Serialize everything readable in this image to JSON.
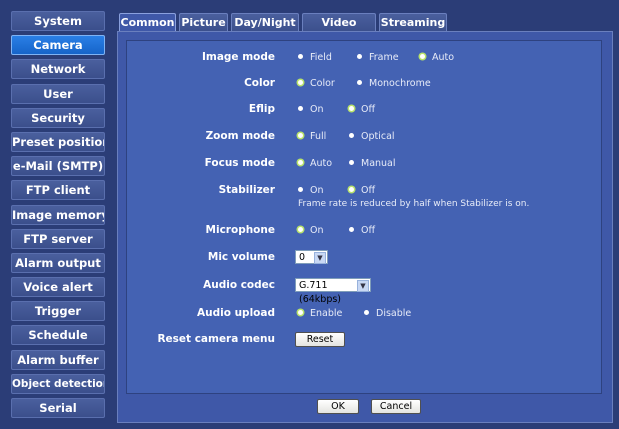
{
  "sidebar": {
    "items": [
      {
        "label": "System"
      },
      {
        "label": "Camera",
        "active": true
      },
      {
        "label": "Network"
      },
      {
        "label": "User"
      },
      {
        "label": "Security"
      },
      {
        "label": "Preset position"
      },
      {
        "label": "e-Mail (SMTP)"
      },
      {
        "label": "FTP client"
      },
      {
        "label": "Image memory"
      },
      {
        "label": "FTP server"
      },
      {
        "label": "Alarm output"
      },
      {
        "label": "Voice alert"
      },
      {
        "label": "Trigger"
      },
      {
        "label": "Schedule"
      },
      {
        "label": "Alarm buffer"
      },
      {
        "label": "Object detection"
      },
      {
        "label": "Serial"
      }
    ]
  },
  "tabs": [
    {
      "label": "Common",
      "active": true
    },
    {
      "label": "Picture"
    },
    {
      "label": "Day/Night"
    },
    {
      "label": "Video codec"
    },
    {
      "label": "Streaming"
    }
  ],
  "form": {
    "image_mode": {
      "label": "Image mode",
      "options": [
        "Field",
        "Frame",
        "Auto"
      ],
      "selected": "Auto"
    },
    "color": {
      "label": "Color",
      "options": [
        "Color",
        "Monochrome"
      ],
      "selected": "Color"
    },
    "eflip": {
      "label": "Eflip",
      "options": [
        "On",
        "Off"
      ],
      "selected": "Off"
    },
    "zoom_mode": {
      "label": "Zoom mode",
      "options": [
        "Full",
        "Optical"
      ],
      "selected": "Full"
    },
    "focus_mode": {
      "label": "Focus mode",
      "options": [
        "Auto",
        "Manual"
      ],
      "selected": "Auto"
    },
    "stabilizer": {
      "label": "Stabilizer",
      "options": [
        "On",
        "Off"
      ],
      "selected": "Off",
      "note": "Frame rate is reduced by half when Stabilizer is on."
    },
    "microphone": {
      "label": "Microphone",
      "options": [
        "On",
        "Off"
      ],
      "selected": "On"
    },
    "mic_volume": {
      "label": "Mic volume",
      "value": "0"
    },
    "audio_codec": {
      "label": "Audio codec",
      "value": "G.711 (64kbps)"
    },
    "audio_upload": {
      "label": "Audio upload",
      "options": [
        "Enable",
        "Disable"
      ],
      "selected": "Enable"
    },
    "reset_camera_menu": {
      "label": "Reset camera menu",
      "button": "Reset"
    }
  },
  "footer": {
    "ok": "OK",
    "cancel": "Cancel"
  },
  "colors": {
    "background": "#2b3d77",
    "panel": "#3f58a8",
    "active_button": "#1664c9",
    "radio_selected_ring": "#b9e36a"
  },
  "icons": {
    "radio": "radio-dot-icon",
    "dropdown": "chevron-down-icon"
  }
}
